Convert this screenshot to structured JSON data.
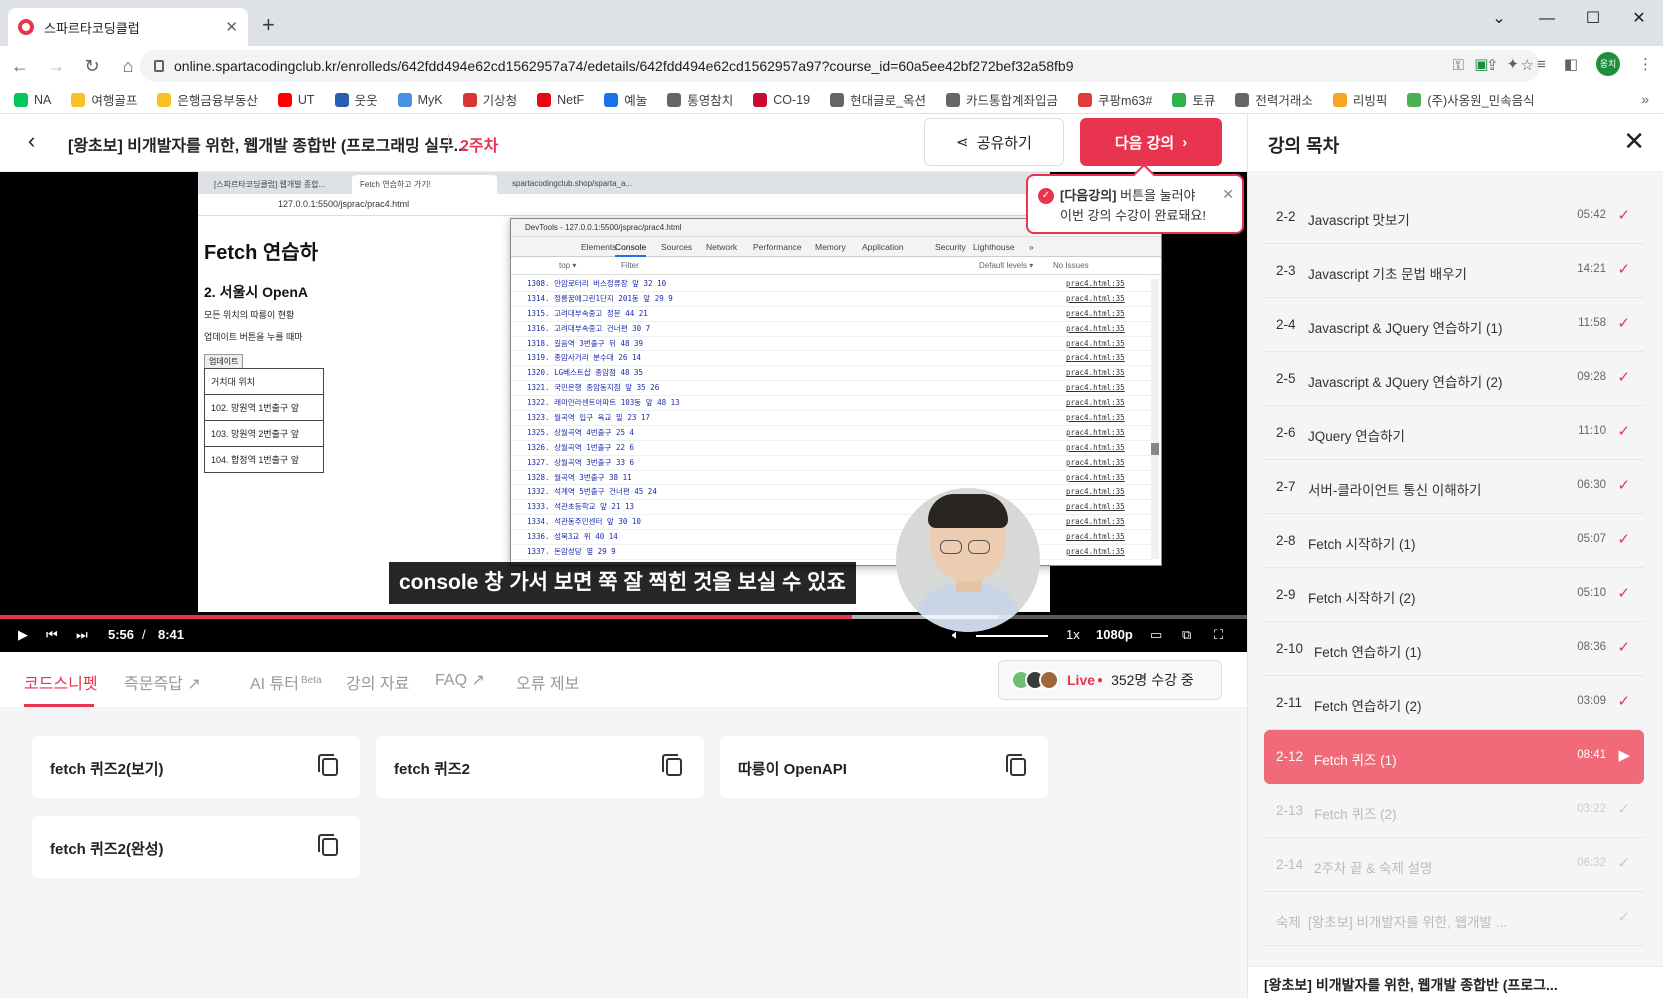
{
  "browser": {
    "tab_title": "스파르타코딩클럽",
    "url": "online.spartacodingclub.kr/enrolleds/642fdd494e62cd1562957a74/edetails/642fdd494e62cd1562957a97?course_id=60a5ee42bf272bef32a58fb9",
    "profile_initials": "옹치",
    "bookmarks": [
      {
        "label": "NA",
        "color": "#03c75a"
      },
      {
        "label": "여행골프",
        "color": "#f6c026"
      },
      {
        "label": "은행금융부동산",
        "color": "#f6c026"
      },
      {
        "label": "UT",
        "color": "#ff0000"
      },
      {
        "label": "웃웃",
        "color": "#2a5fb0"
      },
      {
        "label": "MyK",
        "color": "#4a90e2"
      },
      {
        "label": "기상청",
        "color": "#d33"
      },
      {
        "label": "NetF",
        "color": "#e50914"
      },
      {
        "label": "예눌",
        "color": "#1a73e8"
      },
      {
        "label": "통영참치",
        "color": "#666"
      },
      {
        "label": "CO-19",
        "color": "#c60c30"
      },
      {
        "label": "현대글로_옥션",
        "color": "#666"
      },
      {
        "label": "카드통합계좌입금",
        "color": "#666"
      },
      {
        "label": "쿠팡m63#",
        "color": "#e03a3a"
      },
      {
        "label": "토큐",
        "color": "#2eb34a"
      },
      {
        "label": "전력거래소",
        "color": "#666"
      },
      {
        "label": "리빙픽",
        "color": "#f5a623"
      },
      {
        "label": "(주)사옹원_민속음식",
        "color": "#4caf50"
      }
    ]
  },
  "header": {
    "course_title": "[왕초보] 비개발자를 위한, 웹개발 종합반 (프로그래밍 실무...",
    "week": "2주차",
    "share_label": "공유하기",
    "next_label": "다음 강의"
  },
  "tooltip": {
    "bold": "[다음강의]",
    "line1_rest": " 버튼을 눌러야",
    "line2": "이번 강의 수강이 완료돼요!"
  },
  "video": {
    "inner_tabs": [
      "[스파르타코딩클럽] 웹개발 종합...",
      "Fetch 연습하고 가기!",
      "spartacodingclub.shop/sparta_a..."
    ],
    "inner_url": "127.0.0.1:5500/jsprac/prac4.html",
    "page_heading": "Fetch 연습하",
    "page_subheading": "2. 서울시 OpenA",
    "page_text1": "모든 위치의 따릉이 현황",
    "page_text2": "업데이트 버튼을 누를 때마",
    "update_button": "업데이트",
    "table_rows": [
      "거치대 위치",
      "102. 망원역 1번출구 앞",
      "103. 망원역 2번출구 앞",
      "104. 합정역 1번출구 앞"
    ],
    "devtools": {
      "title": "DevTools - 127.0.0.1:5500/jsprac/prac4.html",
      "tabs": [
        "Elements",
        "Console",
        "Sources",
        "Network",
        "Performance",
        "Memory",
        "Application",
        "Security",
        "Lighthouse",
        "»"
      ],
      "context": "top ▾",
      "filter_placeholder": "Filter",
      "levels": "Default levels ▾",
      "issues": "No Issues",
      "source": "prac4.html:35",
      "logs": [
        "1308. 안암로터리 버스정류장 앞 32 10",
        "1314. 정릉꿈에그린1단지 201동 앞 29 9",
        "1315. 고려대부속중고 정문 44 21",
        "1316. 고려대부속중고 건너편 30 7",
        "1318. 길음역 3번출구 뒤 48 39",
        "1319. 종암사거리 분수대 26 14",
        "1320. LG베스트샵 종암점 48 35",
        "1321. 국민은행 종암동지점 앞 35 26",
        "1322. 래미안라센트아파트 103동 앞 48 13",
        "1323. 월곡역 입구 육교 밑 23 17",
        "1325. 상월곡역 4번출구 25 4",
        "1326. 상월곡역 1번출구 22 6",
        "1327. 상월곡역 3번출구 33 6",
        "1328. 월곡역 3번출구 38 11",
        "1332. 석계역 5번출구 건너편 45 24",
        "1333. 석관초등학교 앞 21 13",
        "1334. 석관동주민센터 앞 30 10",
        "1336. 성북3교 위 40 14",
        "1337. 돈암성당 옆 29 9"
      ]
    },
    "subtitle": "console 창 가서 보면 쭉 잘 찍힌 것을 보실 수 있죠",
    "current_time": "5:56",
    "duration": "8:41",
    "played_fraction": 0.683,
    "buffered_fraction": 0.8,
    "speed": "1x",
    "quality": "1080p"
  },
  "subtabs": [
    {
      "label": "코드스니펫",
      "active": true
    },
    {
      "label": "즉문즉답 ↗",
      "active": false
    },
    {
      "label": "AI 튜터",
      "active": false,
      "badge": "Beta"
    },
    {
      "label": "강의 자료",
      "active": false
    },
    {
      "label": "FAQ ↗",
      "active": false
    },
    {
      "label": "오류 제보",
      "active": false
    }
  ],
  "live": {
    "label": "Live",
    "count": "352명 수강 중"
  },
  "snippets": [
    "fetch 퀴즈2(보기)",
    "fetch 퀴즈2",
    "따릉이 OpenAPI",
    "fetch 퀴즈2(완성)"
  ],
  "sidebar": {
    "title": "강의 목차",
    "items": [
      {
        "num": "2-2",
        "name": "Javascript 맛보기",
        "dur": "05:42",
        "state": "done"
      },
      {
        "num": "2-3",
        "name": "Javascript 기초 문법 배우기",
        "dur": "14:21",
        "state": "done"
      },
      {
        "num": "2-4",
        "name": "Javascript & JQuery 연습하기 (1)",
        "dur": "11:58",
        "state": "done"
      },
      {
        "num": "2-5",
        "name": "Javascript & JQuery 연습하기 (2)",
        "dur": "09:28",
        "state": "done"
      },
      {
        "num": "2-6",
        "name": "JQuery 연습하기",
        "dur": "11:10",
        "state": "done"
      },
      {
        "num": "2-7",
        "name": "서버-클라이언트 통신 이해하기",
        "dur": "06:30",
        "state": "done"
      },
      {
        "num": "2-8",
        "name": "Fetch 시작하기 (1)",
        "dur": "05:07",
        "state": "done"
      },
      {
        "num": "2-9",
        "name": "Fetch 시작하기 (2)",
        "dur": "05:10",
        "state": "done"
      },
      {
        "num": "2-10",
        "name": "Fetch 연습하기 (1)",
        "dur": "08:36",
        "state": "done"
      },
      {
        "num": "2-11",
        "name": "Fetch 연습하기 (2)",
        "dur": "03:09",
        "state": "done"
      },
      {
        "num": "2-12",
        "name": "Fetch 퀴즈 (1)",
        "dur": "08:41",
        "state": "current"
      },
      {
        "num": "2-13",
        "name": "Fetch 퀴즈 (2)",
        "dur": "03:22",
        "state": "todo"
      },
      {
        "num": "2-14",
        "name": "2주차 끝 & 숙제 설명",
        "dur": "06:32",
        "state": "todo"
      },
      {
        "num": "숙제",
        "name": "[왕초보] 비개발자를 위한, 웹개발 ...",
        "dur": "",
        "state": "todo"
      }
    ],
    "footer": "[왕초보] 비개발자를 위한, 웹개발 종합반 (프로그..."
  },
  "colors": {
    "accent": "#e8344e",
    "current_item": "#f06a7a"
  }
}
